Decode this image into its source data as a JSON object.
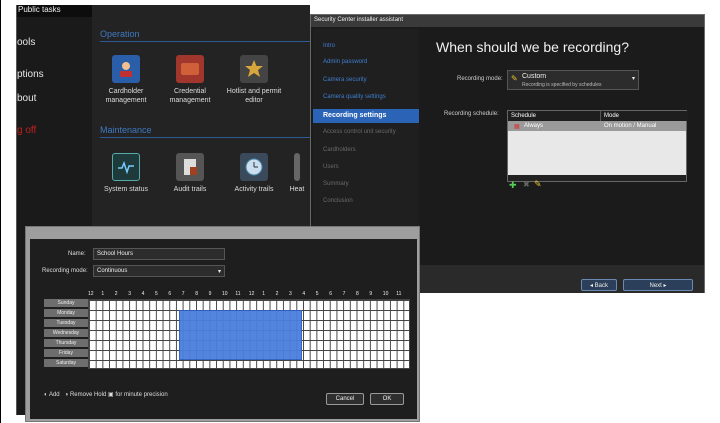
{
  "sidebar": {
    "title": "Public tasks",
    "items": [
      "ools",
      "ptions",
      "bout",
      "g off"
    ]
  },
  "main": {
    "sections": {
      "operation": "Operation",
      "maintenance": "Maintenance"
    },
    "op_tiles": [
      "Cardholder management",
      "Credential management",
      "Hotlist and permit editor"
    ],
    "mt_tiles": [
      "System status",
      "Audit trails",
      "Activity trails",
      "Heat"
    ]
  },
  "wizard": {
    "title": "Security Center installer assistant",
    "steps": [
      "Intro",
      "Admin password",
      "Camera security",
      "Camera quality settings",
      "Recording settings",
      "Access control unit security",
      "Cardholders",
      "Users",
      "Summary",
      "Conclusion"
    ],
    "heading": "When should we be recording?",
    "mode_label": "Recording mode:",
    "mode_value": "Custom",
    "mode_sub": "Recording is specified by schedules",
    "schedule_label": "Recording schedule:",
    "schedule_cols": [
      "Schedule",
      "Mode"
    ],
    "schedule_row": [
      "Always",
      "On motion / Manual"
    ],
    "back": "Back",
    "next": "Next"
  },
  "dialog": {
    "name_label": "Name:",
    "name_value": "School Hours",
    "mode_label": "Recording mode:",
    "mode_value": "Continuous",
    "hours": [
      "12",
      "1",
      "2",
      "3",
      "4",
      "5",
      "6",
      "7",
      "8",
      "9",
      "10",
      "11",
      "12",
      "1",
      "2",
      "3",
      "4",
      "5",
      "6",
      "7",
      "8",
      "9",
      "10",
      "11"
    ],
    "days": [
      "Sunday",
      "Monday",
      "Tuesday",
      "Wednesday",
      "Thursday",
      "Friday",
      "Saturday"
    ],
    "hint_add": "Add",
    "hint_remove": "Remove",
    "hint_hold": "Hold",
    "hint_precision": "for minute precision",
    "cancel": "Cancel",
    "ok": "OK"
  },
  "colors": {
    "accent": "#2b64b7",
    "selection": "#4b7fdd",
    "link": "#3f7fd0",
    "danger": "#c0201e"
  }
}
